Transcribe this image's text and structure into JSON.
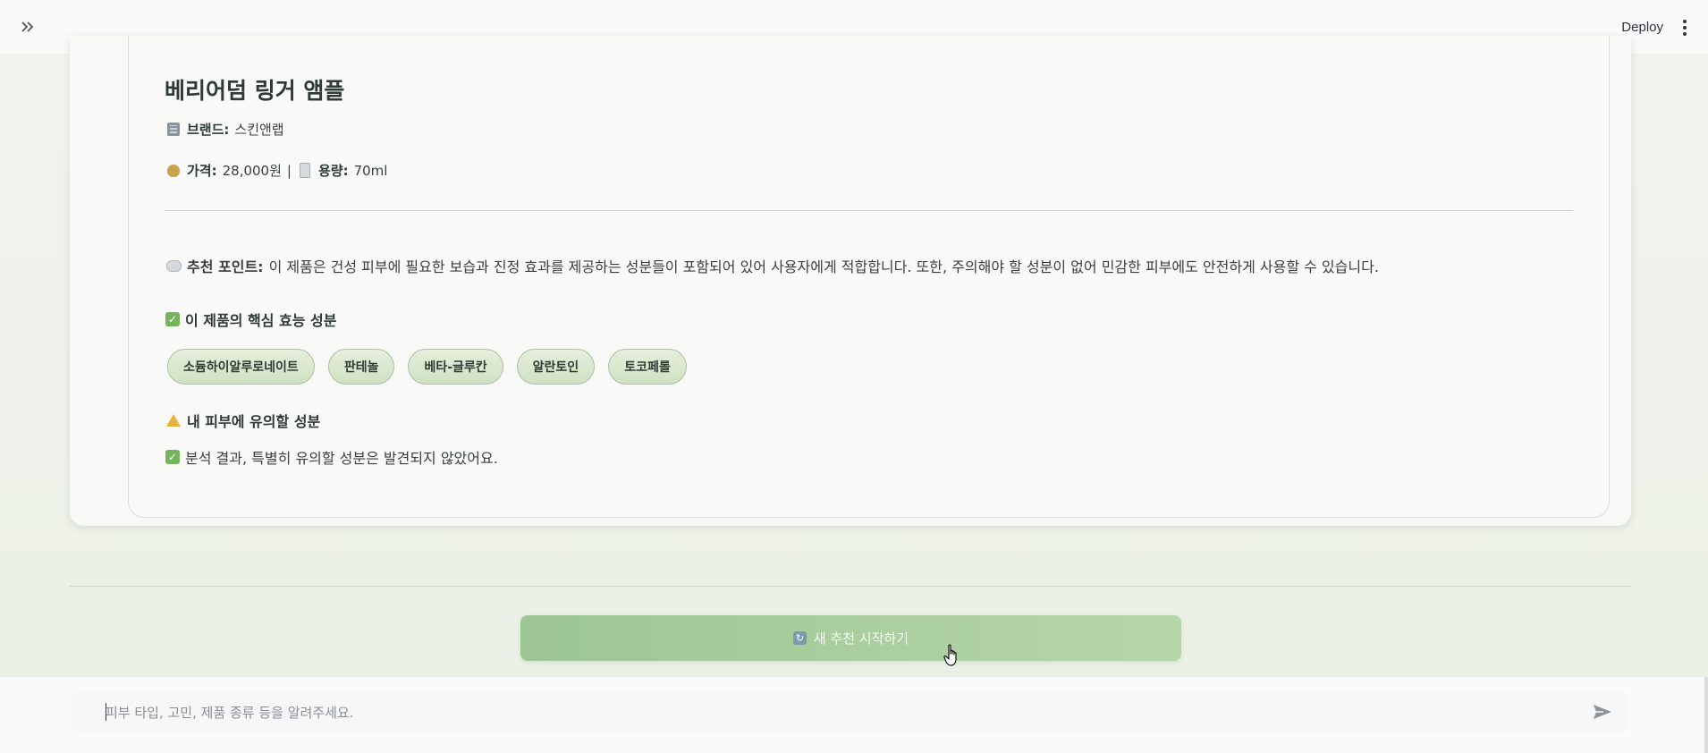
{
  "header": {
    "expand_icon": "double-chevron-right-icon",
    "deploy_label": "Deploy",
    "menu_icon": "vertical-dots-icon"
  },
  "product": {
    "name": "베리어덤 링거 앰플",
    "brand_label": "브랜드:",
    "brand_value": "스킨앤랩",
    "price_label": "가격:",
    "price_value": "28,000원",
    "separator": "|",
    "volume_label": "용량:",
    "volume_value": "70ml"
  },
  "recommendation": {
    "label": "추천 포인트:",
    "text": "이 제품은 건성 피부에 필요한 보습과 진정 효과를 제공하는 성분들이 포함되어 있어 사용자에게 적합합니다. 또한, 주의해야 할 성분이 없어 민감한 피부에도 안전하게 사용할 수 있습니다."
  },
  "key_ingredients": {
    "title": "이 제품의 핵심 효능 성분",
    "items": [
      "소듐하이알루로네이트",
      "판테놀",
      "베타-글루칸",
      "알란토인",
      "토코페롤"
    ]
  },
  "caution": {
    "title": "내 피부에 유의할 성분",
    "result": "분석 결과, 특별히 유의할 성분은 발견되지 않았어요."
  },
  "actions": {
    "new_recommendation": "새 추천 시작하기"
  },
  "chat": {
    "placeholder": "피부 타입, 고민, 제품 종류 등을 알려주세요."
  },
  "colors": {
    "accent_green": "#9cc694",
    "chip_bg": "#d9e7ce",
    "text_dark": "#2f3a33"
  }
}
